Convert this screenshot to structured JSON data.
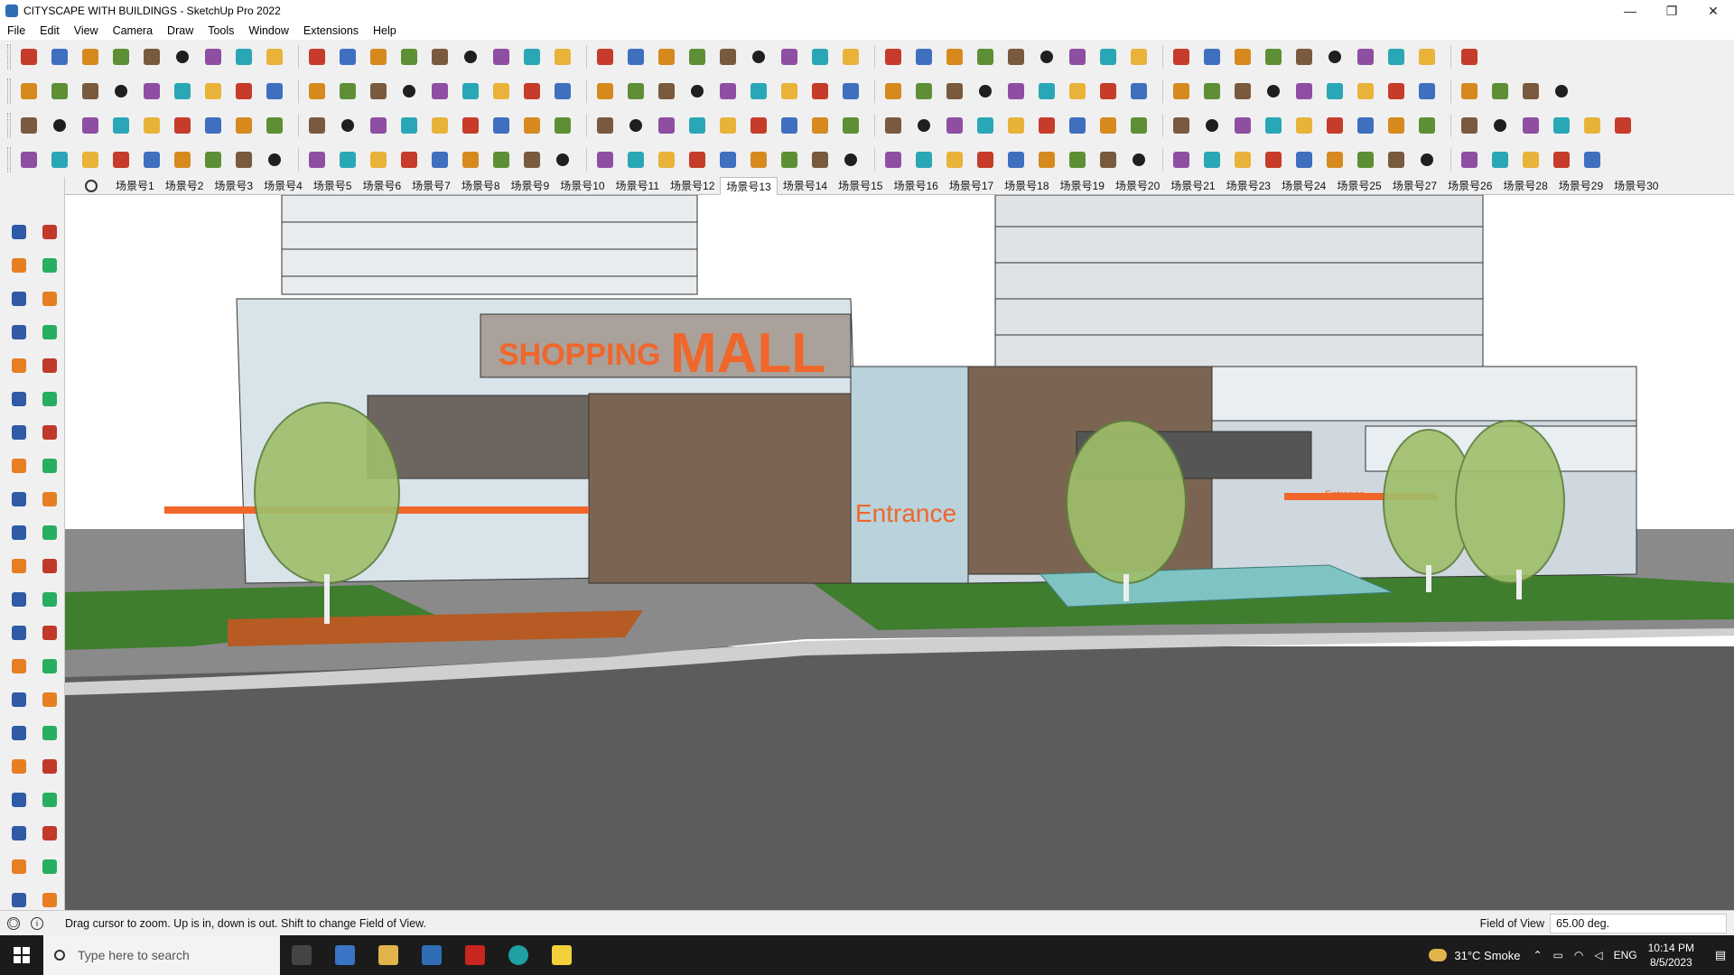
{
  "window": {
    "title": "CITYSCAPE WITH BUILDINGS - SketchUp Pro 2022",
    "controls": [
      "—",
      "❐",
      "✕"
    ]
  },
  "menu": [
    "File",
    "Edit",
    "View",
    "Camera",
    "Draw",
    "Tools",
    "Window",
    "Extensions",
    "Help"
  ],
  "scenes": {
    "tabs": [
      "场景号1",
      "场景号2",
      "场景号3",
      "场景号4",
      "场景号5",
      "场景号6",
      "场景号7",
      "场景号8",
      "场景号9",
      "场景号10",
      "场景号11",
      "场景号12",
      "场景号13",
      "场景号14",
      "场景号15",
      "场景号16",
      "场景号17",
      "场景号18",
      "场景号19",
      "场景号20",
      "场景号21",
      "场景号23",
      "场景号24",
      "场景号25",
      "场景号27",
      "场景号26",
      "场景号28",
      "场景号29",
      "场景号30"
    ],
    "active_index": 12
  },
  "model": {
    "sign_shopping": "SHOPPING",
    "sign_mall": "MALL",
    "sign_entrance": "Entrance",
    "sign_entrance_small": "Entrance"
  },
  "status": {
    "hint": "Drag cursor to zoom.  Up is in, down is out. Shift to change Field of View.",
    "fov_label": "Field of View",
    "fov_value": "65.00 deg."
  },
  "taskbar": {
    "search_placeholder": "Type here to search",
    "weather": "31°C  Smoke",
    "language": "ENG",
    "time": "10:14 PM",
    "date": "8/5/2023"
  },
  "colors": {
    "sky": "#ffffff",
    "grass": "#3f7d2f",
    "road": "#5a5a5a",
    "accent_orange": "#f0662b",
    "facade_brown": "#7b6552"
  }
}
